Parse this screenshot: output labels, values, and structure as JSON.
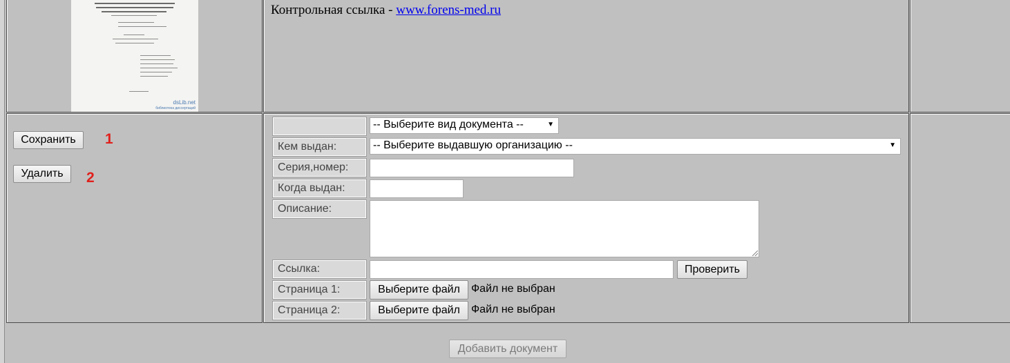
{
  "info": {
    "link_prefix": "Контрольная ссылка - ",
    "link_text": "www.forens-med.ru"
  },
  "thumbnail": {
    "site_logo": "dsLib.net",
    "site_caption": "библиотека диссертаций"
  },
  "actions": {
    "save_label": "Сохранить",
    "delete_label": "Удалить",
    "marker_1": "1",
    "marker_2": "2"
  },
  "form": {
    "doc_type": {
      "label": "",
      "selected": "-- Выберите вид документа --"
    },
    "issuer": {
      "label": "Кем выдан:",
      "selected": "-- Выберите выдавшую организацию --"
    },
    "series": {
      "label": "Серия,номер:",
      "value": ""
    },
    "issued_date": {
      "label": "Когда выдан:",
      "value": ""
    },
    "description": {
      "label": "Описание:",
      "value": ""
    },
    "link": {
      "label": "Ссылка:",
      "value": "",
      "check_label": "Проверить"
    },
    "page1": {
      "label": "Страница 1:",
      "choose_label": "Выберите файл",
      "status": "Файл не выбран"
    },
    "page2": {
      "label": "Страница 2:",
      "choose_label": "Выберите файл",
      "status": "Файл не выбран"
    }
  },
  "footer": {
    "add_document_label": "Добавить документ"
  },
  "colors": {
    "page_bg": "#c0c0c0",
    "marker": "#e0201c",
    "link": "#0000ee"
  },
  "icons": {
    "dropdown": "dropdown-arrow-icon",
    "resize": "resize-handle-icon"
  }
}
